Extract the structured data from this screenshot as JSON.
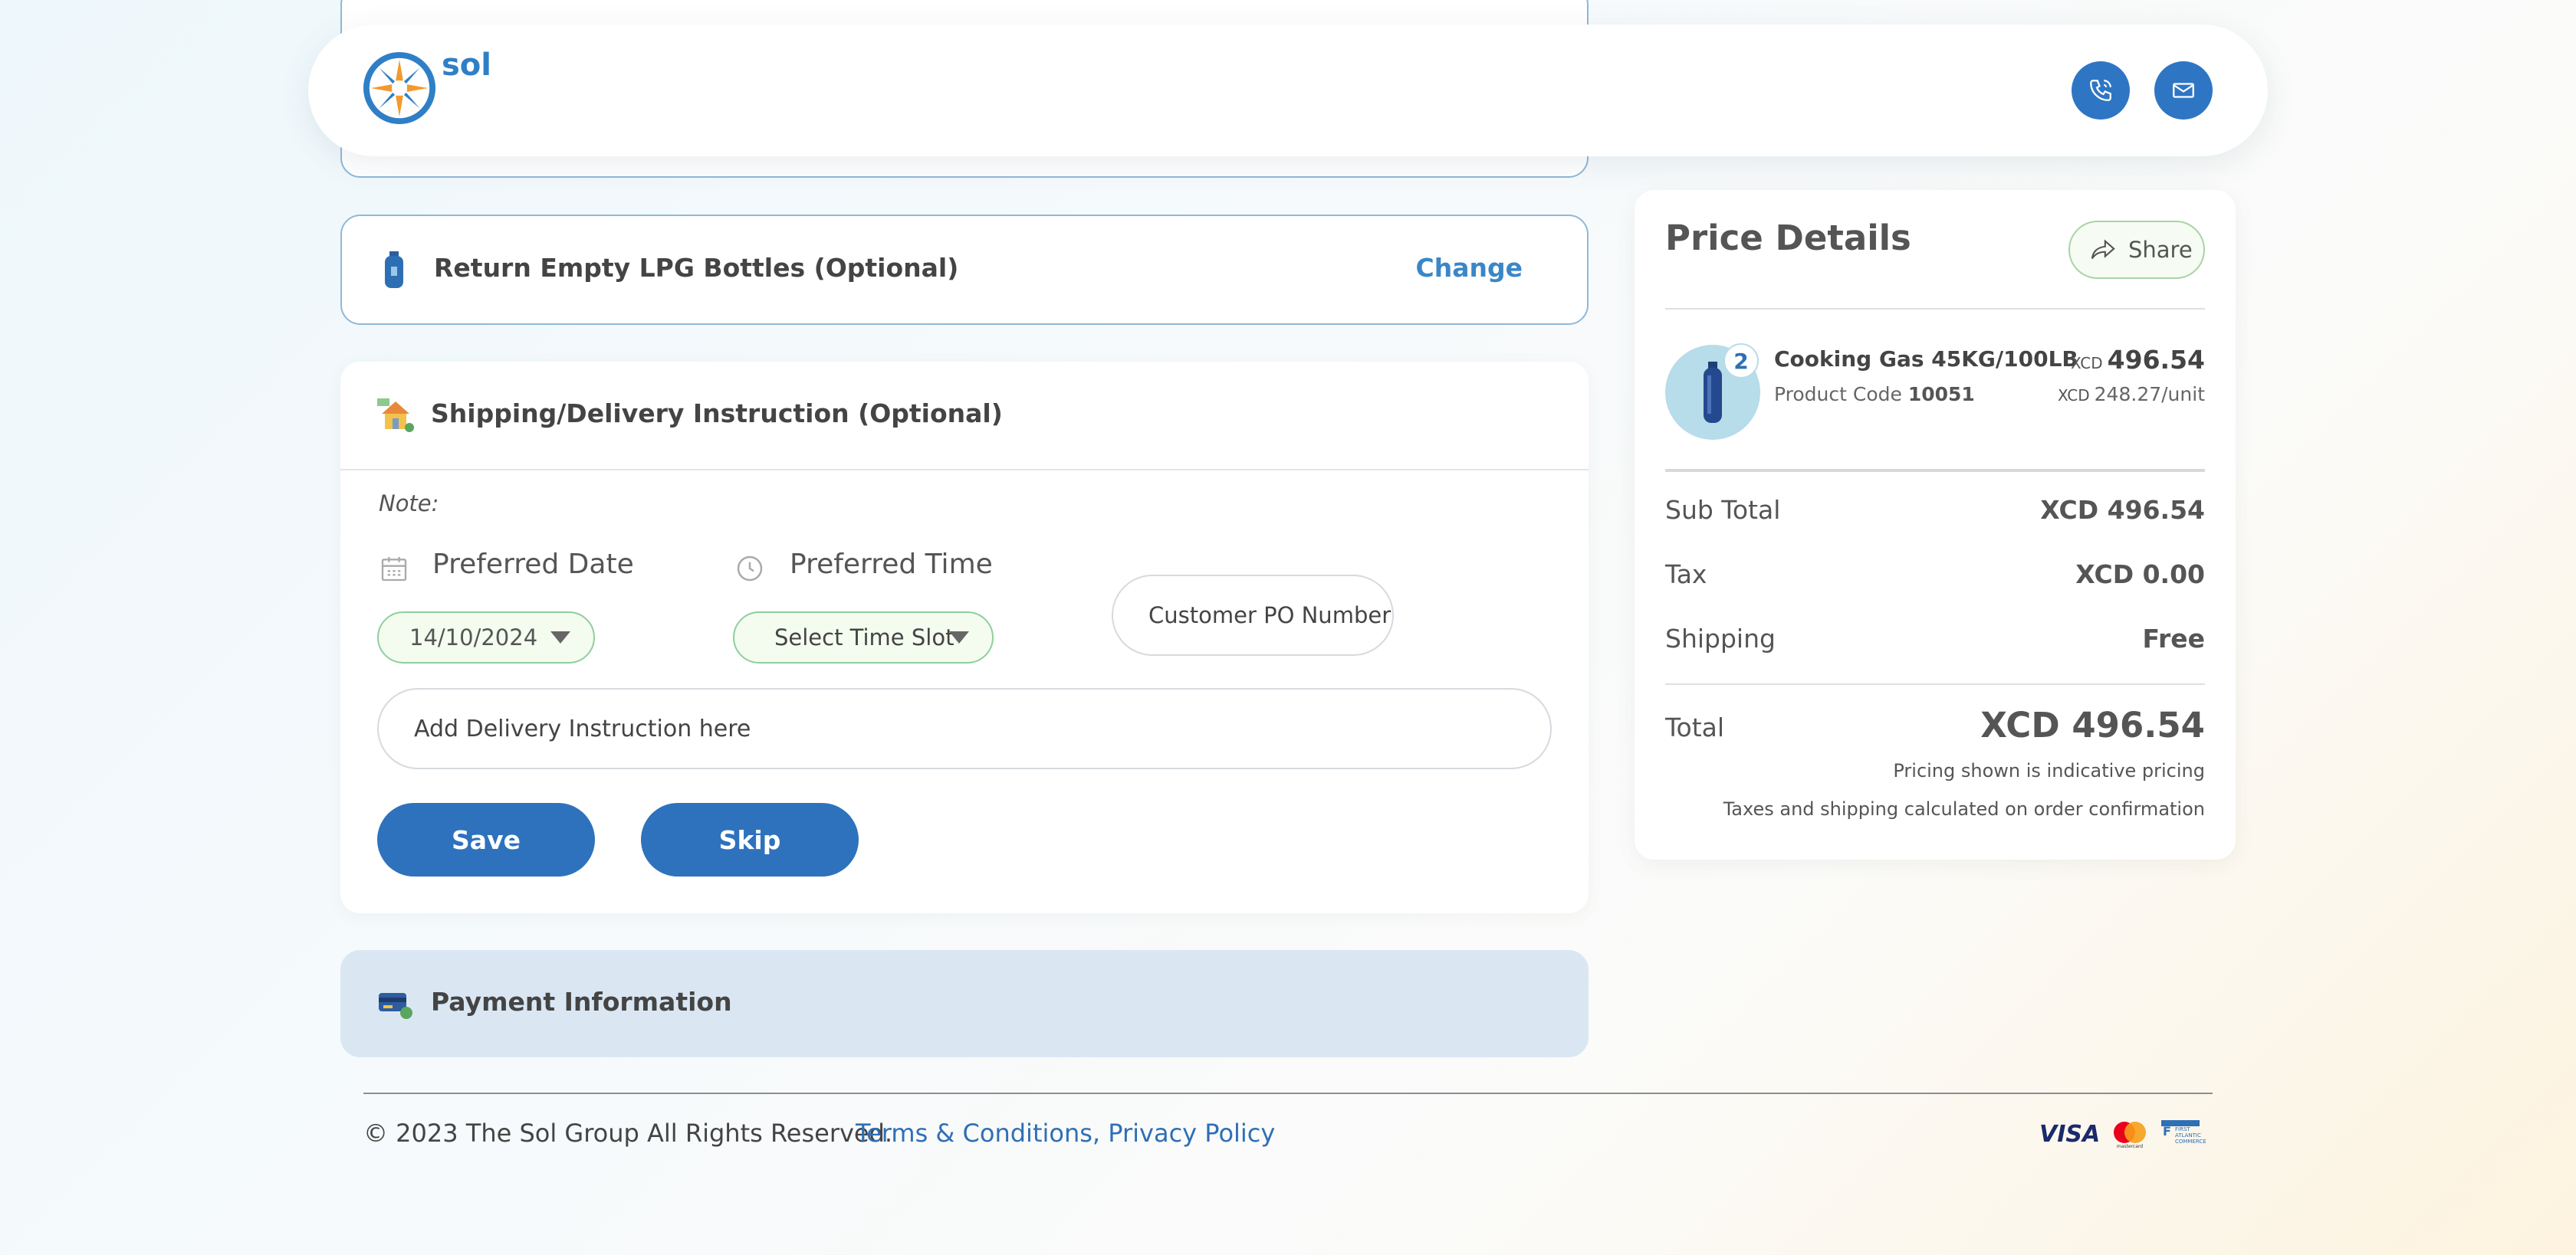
{
  "header": {
    "brand": "sol",
    "phone_icon": "phone-icon",
    "mail_icon": "mail-icon"
  },
  "return_bottles": {
    "title": "Return Empty LPG Bottles (Optional)",
    "change_label": "Change",
    "icon": "gas-bottle-icon"
  },
  "shipping": {
    "title": "Shipping/Delivery Instruction (Optional)",
    "note_label": "Note:",
    "preferred_date_label": "Preferred Date",
    "preferred_time_label": "Preferred Time",
    "date_value": "14/10/2024",
    "time_value": "Select Time Slot",
    "po_placeholder": "Customer PO Number",
    "instruction_placeholder": "Add Delivery Instruction here",
    "save_label": "Save",
    "skip_label": "Skip"
  },
  "payment": {
    "title": "Payment Information"
  },
  "price_details": {
    "title": "Price Details",
    "share_label": "Share",
    "product": {
      "quantity": "2",
      "name": "Cooking Gas 45KG/100LB",
      "code_label": "Product Code",
      "code": "10051",
      "currency": "XCD",
      "price": "496.54",
      "unit_price": "248.27/unit"
    },
    "subtotal_label": "Sub Total",
    "subtotal_value": "XCD 496.54",
    "tax_label": "Tax",
    "tax_value": "XCD 0.00",
    "shipping_label": "Shipping",
    "shipping_value": "Free",
    "total_label": "Total",
    "total_value": "XCD 496.54",
    "note1": "Pricing shown is indicative pricing",
    "note2": "Taxes and shipping calculated on order confirmation"
  },
  "footer": {
    "copyright": "© 2023 The Sol Group All Rights Reserved.",
    "terms": "Terms & Conditions,",
    "privacy": "Privacy Policy",
    "card_logos": [
      "VISA",
      "mastercard",
      "First Atlantic Commerce"
    ]
  },
  "colors": {
    "primary": "#2e72bd",
    "link": "#3a87c8",
    "accent_green": "#8fcf9b",
    "payment_bg": "#dae7f3"
  }
}
